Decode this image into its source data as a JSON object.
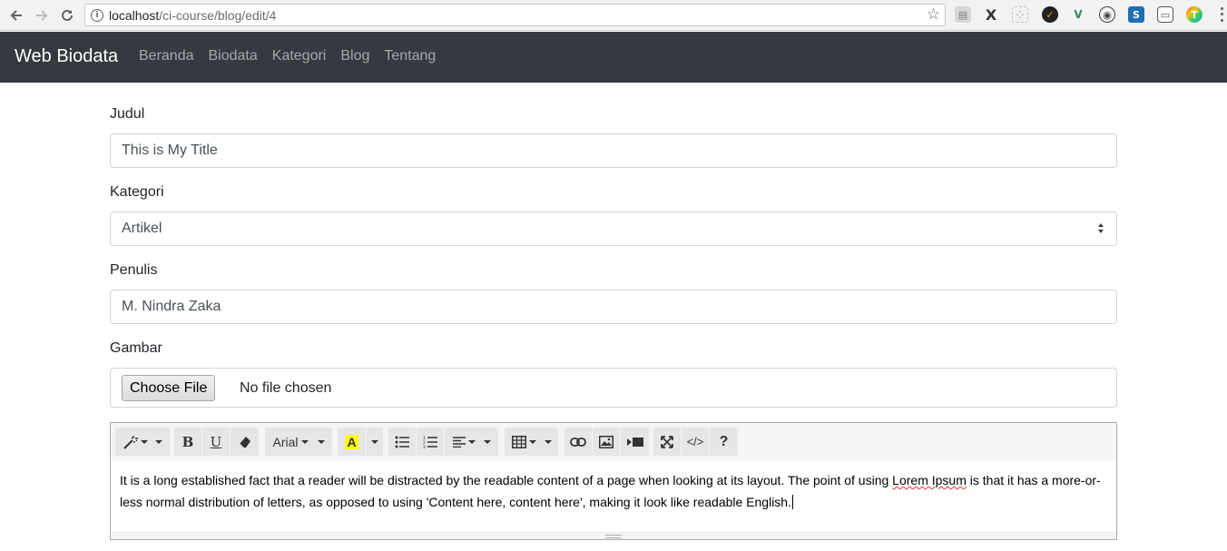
{
  "browser": {
    "url_host": "localhost",
    "url_path": "/ci-course/blog/edit/4"
  },
  "navbar": {
    "brand": "Web Biodata",
    "links": [
      "Beranda",
      "Biodata",
      "Kategori",
      "Blog",
      "Tentang"
    ]
  },
  "form": {
    "judul": {
      "label": "Judul",
      "value": "This is My Title"
    },
    "kategori": {
      "label": "Kategori",
      "selected": "Artikel"
    },
    "penulis": {
      "label": "Penulis",
      "value": "M. Nindra Zaka"
    },
    "gambar": {
      "label": "Gambar",
      "button": "Choose File",
      "status": "No file chosen"
    }
  },
  "editor": {
    "font_name": "Arial",
    "content_before": "It is a long established fact that a reader will be distracted by the readable content of a page when looking at its layout. The point of using ",
    "content_spell": "Lorem Ipsum",
    "content_after": " is that it has a more-or-less normal distribution of letters, as opposed to using 'Content here, content here', making it look like readable English.",
    "code_view_label": "</>",
    "help_label": "?",
    "bold_label": "B",
    "underline_label": "U",
    "color_label": "A"
  }
}
